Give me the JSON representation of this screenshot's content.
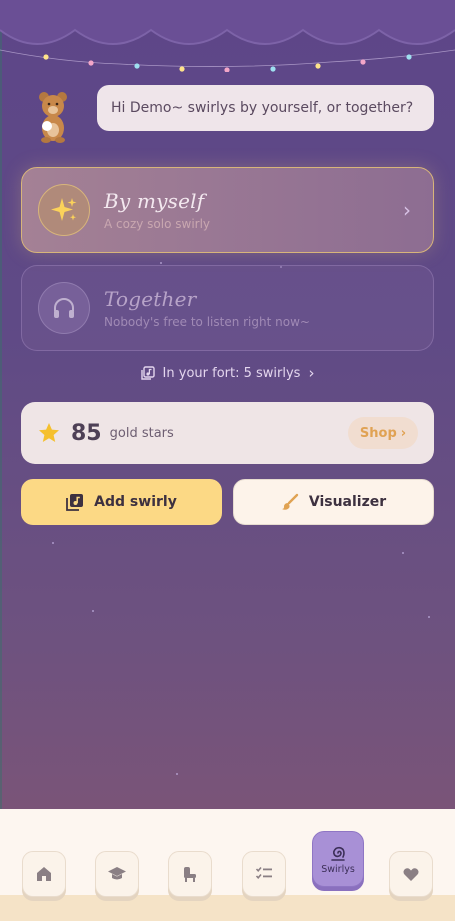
{
  "greeting": {
    "text": "Hi Demo~ swirlys by yourself, or together?"
  },
  "options": {
    "solo": {
      "title": "By myself",
      "subtitle": "A cozy solo swirly"
    },
    "together": {
      "title": "Together",
      "subtitle": "Nobody's free to listen right now~"
    }
  },
  "fort": {
    "label": "In your fort: 5 swirlys"
  },
  "stars": {
    "count": "85",
    "label": "gold stars",
    "shop_label": "Shop"
  },
  "actions": {
    "add_label": "Add swirly",
    "visualizer_label": "Visualizer"
  },
  "nav": {
    "items": [
      {
        "icon": "home-icon"
      },
      {
        "icon": "graduation-cap-icon"
      },
      {
        "icon": "chair-icon"
      },
      {
        "icon": "checklist-icon"
      },
      {
        "icon": "swirl-icon",
        "label": "Swirlys",
        "active": true
      },
      {
        "icon": "heart-icon"
      }
    ]
  },
  "colors": {
    "accent_yellow": "#fcd985",
    "accent_purple": "#a890d6",
    "shop_text": "#e0a253",
    "star": "#f5c02e"
  }
}
